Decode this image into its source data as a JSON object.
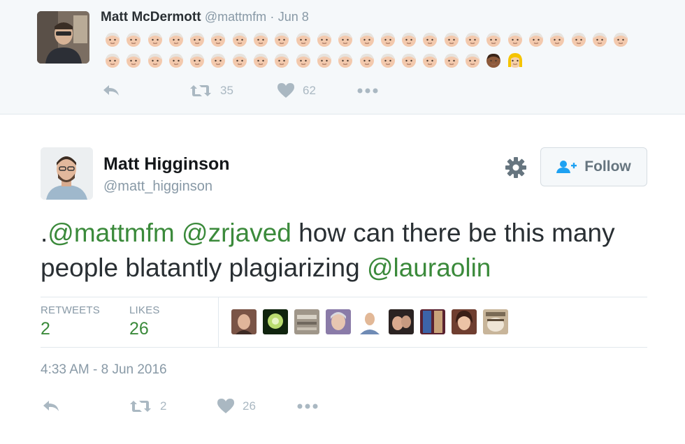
{
  "parent_tweet": {
    "author_name": "Matt McDermott",
    "author_handle": "@mattmfm",
    "separator": "·",
    "date": "Jun 8",
    "emoji_row_1_count": 25,
    "emoji_row_2_count": 18,
    "emoji_extra": [
      "man-dark-skin-emoji",
      "person-blond-hair-emoji"
    ],
    "retweet_count": "35",
    "like_count": "62"
  },
  "main_tweet": {
    "author_name": "Matt Higginson",
    "author_handle": "@matt_higginson",
    "follow_label": "Follow",
    "text_parts": [
      {
        "text": ".",
        "mention": false
      },
      {
        "text": "@mattmfm",
        "mention": true
      },
      {
        "text": " ",
        "mention": false
      },
      {
        "text": "@zrjaved",
        "mention": true
      },
      {
        "text": " how can there be this many people blatantly plagiarizing ",
        "mention": false
      },
      {
        "text": "@lauraolin",
        "mention": true
      }
    ],
    "retweets_label": "RETWEETS",
    "retweets_value": "2",
    "likes_label": "LIKES",
    "likes_value": "26",
    "timestamp": "4:33 AM - 8 Jun 2016",
    "footer_retweet_count": "2",
    "footer_like_count": "26"
  },
  "colors": {
    "mention": "#3b8a3b",
    "muted": "#8899a6",
    "action_icon": "#aab8c2",
    "parent_background": "#f5f8fa"
  },
  "likers": [
    "liker-1",
    "liker-2",
    "liker-3",
    "liker-4",
    "liker-5",
    "liker-6",
    "liker-7",
    "liker-8",
    "liker-9"
  ]
}
